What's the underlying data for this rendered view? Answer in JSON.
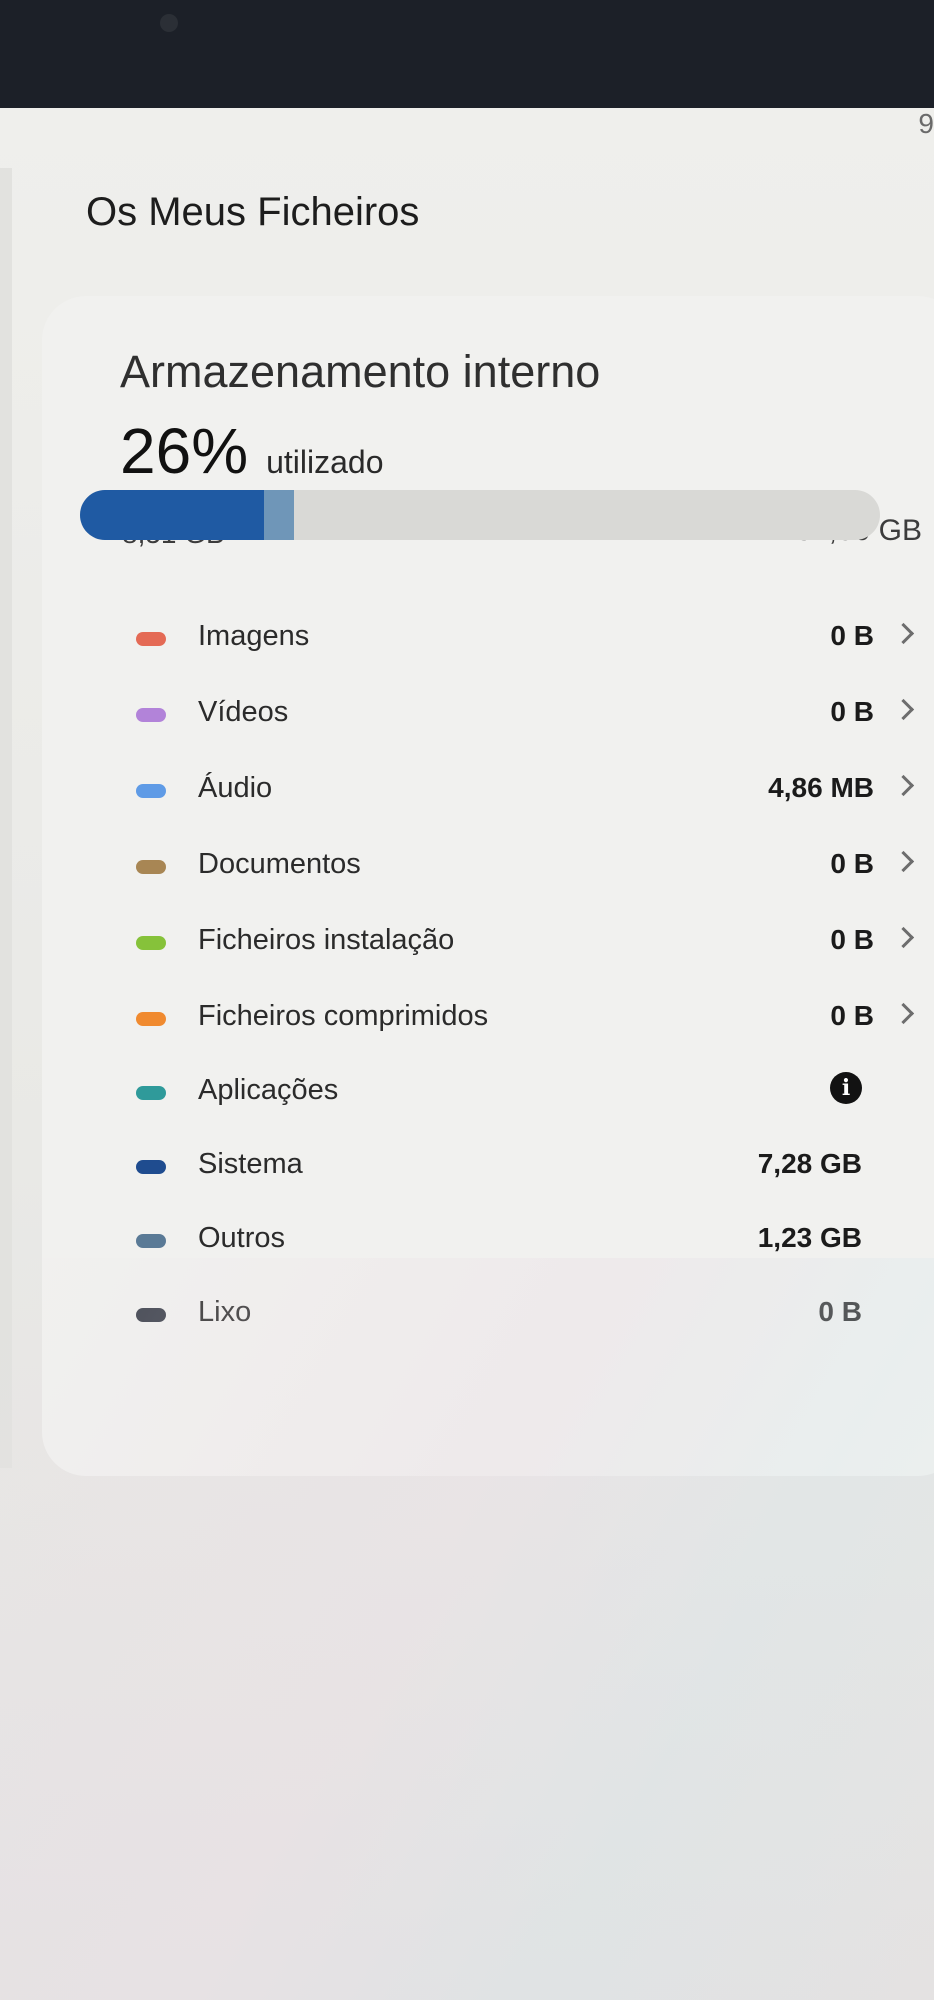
{
  "status_bar": {
    "time_fragment": "9"
  },
  "header": {
    "title": "Os Meus Ficheiros"
  },
  "storage": {
    "title": "Armazenamento interno",
    "percent_used": "26%",
    "used_word": "utilizado",
    "used_size": "8,51 GB",
    "total_size": "32,00 GB",
    "bar_fill": {
      "system_fraction": 0.23,
      "others_fraction": 0.037
    },
    "colors": {
      "system": "#1f5aa3",
      "others": "#6f96b8",
      "track": "#d9d9d6"
    }
  },
  "categories": [
    {
      "label": "Imagens",
      "size": "0 B",
      "color": "#e46a55",
      "navigable": true
    },
    {
      "label": "Vídeos",
      "size": "0 B",
      "color": "#b283d9",
      "navigable": true
    },
    {
      "label": "Áudio",
      "size": "4,86 MB",
      "color": "#5f9be6",
      "navigable": true
    },
    {
      "label": "Documentos",
      "size": "0 B",
      "color": "#a88654",
      "navigable": true
    },
    {
      "label": "Ficheiros instalação",
      "size": "0 B",
      "color": "#86c23a",
      "navigable": true
    },
    {
      "label": "Ficheiros comprimidos",
      "size": "0 B",
      "color": "#f08a2f",
      "navigable": true
    },
    {
      "label": "Aplicações",
      "size": "",
      "color": "#2f9a9a",
      "navigable": false,
      "icon": "info-icon"
    },
    {
      "label": "Sistema",
      "size": "7,28 GB",
      "color": "#1f4c8f",
      "navigable": false
    },
    {
      "label": "Outros",
      "size": "1,23 GB",
      "color": "#5a7a96",
      "navigable": false
    },
    {
      "label": "Lixo",
      "size": "0 B",
      "color": "#3a3f4a",
      "navigable": false
    }
  ]
}
